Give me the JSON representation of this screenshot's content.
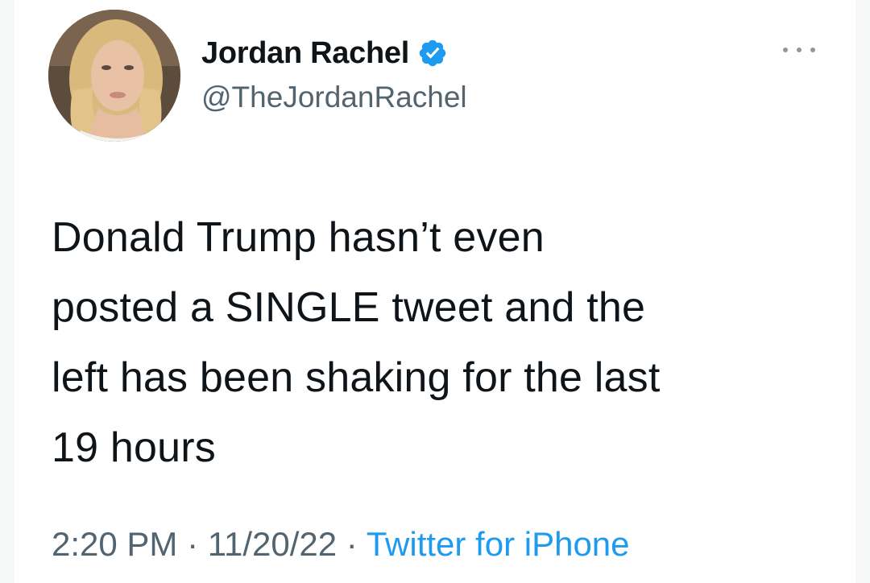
{
  "author": {
    "name": "Jordan Rachel",
    "handle": "@TheJordanRachel",
    "verified": true
  },
  "tweet": {
    "text": "Donald Trump hasn’t even\nposted a SINGLE tweet and the\nleft has been shaking for the last\n19 hours",
    "time": "2:20 PM",
    "separator": " · ",
    "date": "11/20/22",
    "source": "Twitter for iPhone"
  },
  "icons": {
    "verified": "verified-badge-icon",
    "more": "more-options-icon"
  },
  "colors": {
    "accent": "#1d9bf0",
    "secondary_text": "#536471",
    "primary_text": "#0f1419"
  }
}
